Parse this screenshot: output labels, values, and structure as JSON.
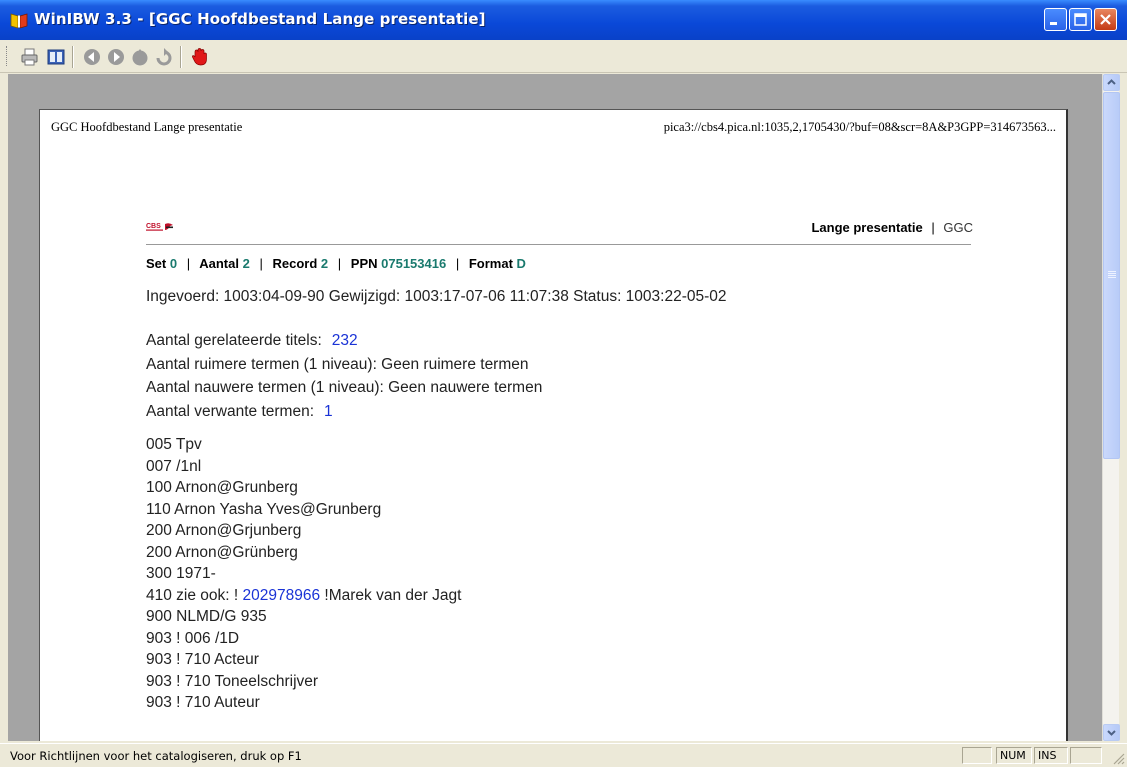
{
  "window": {
    "title": "WinIBW 3.3 - [GGC Hoofdbestand Lange presentatie]"
  },
  "toolbar": {
    "buttons": [
      {
        "name": "print-icon"
      },
      {
        "name": "book-icon"
      },
      {
        "name": "back-icon"
      },
      {
        "name": "forward-icon"
      },
      {
        "name": "home-icon"
      },
      {
        "name": "refresh-icon"
      },
      {
        "name": "stop-hand-icon"
      }
    ]
  },
  "page": {
    "header_left": "GGC Hoofdbestand Lange presentatie",
    "header_right": "pica3://cbs4.pica.nl:1035,2,1705430/?buf=08&scr=8A&P3GPP=314673563...",
    "logo_text": "CBS",
    "presentation_label": "Lange presentatie",
    "presentation_sep": "|",
    "database": "GGC",
    "nav": {
      "set_label": "Set",
      "set_value": "0",
      "aantal_label": "Aantal",
      "aantal_value": "2",
      "record_label": "Record",
      "record_value": "2",
      "ppn_label": "PPN",
      "ppn_value": "075153416",
      "format_label": "Format",
      "format_value": "D",
      "sep": "|"
    },
    "meta_line": "Ingevoerd: 1003:04-09-90 Gewijzigd: 1003:17-07-06 11:07:38 Status: 1003:22-05-02",
    "related": {
      "titles_label": "Aantal gerelateerde titels:",
      "titles_value": "232",
      "broader": "Aantal ruimere termen (1 niveau): Geen ruimere termen",
      "narrower": "Aantal nauwere termen (1 niveau): Geen nauwere termen",
      "related_label": "Aantal verwante termen:",
      "related_value": "1"
    },
    "fields": {
      "f1": "005 Tpv",
      "f2": "007 /1nl",
      "f3": "100 Arnon@Grunberg",
      "f4": "110 Arnon Yasha Yves@Grunberg",
      "f5": "200 Arnon@Grjunberg",
      "f6": "200 Arnon@Grünberg",
      "f7": "300 1971-",
      "f8_prefix": "410 zie ook: !",
      "f8_link": "202978966",
      "f8_suffix": "!Marek van der Jagt",
      "f9": "900 NLMD/G 935",
      "f10": "903 ! 006 /1D",
      "f11": "903 ! 710 Acteur",
      "f12": "903 ! 710 Toneelschrijver",
      "f13": "903 ! 710 Auteur"
    }
  },
  "statusbar": {
    "message": "Voor Richtlijnen voor het catalogiseren, druk op F1",
    "num": "NUM",
    "ins": "INS"
  }
}
